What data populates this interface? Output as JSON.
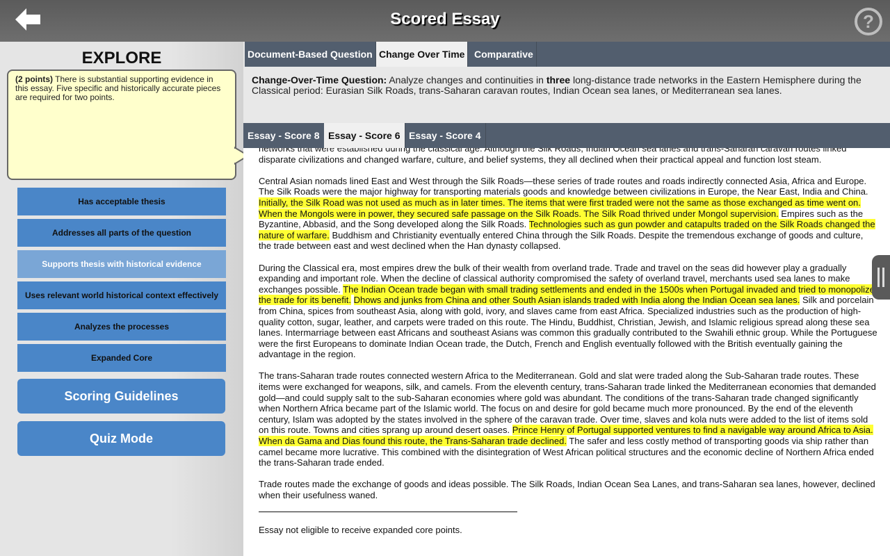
{
  "header": {
    "title": "Scored Essay",
    "back_icon": "back-arrow-icon",
    "help_icon": "help-question-icon"
  },
  "sidebar": {
    "heading": "EXPLORE",
    "callout": {
      "points": "(2 points)",
      "text": " There is substantial supporting evidence in this essay. Five specific and historically accurate pieces are required for two points."
    },
    "rubric_items": [
      {
        "label": "Has acceptable thesis",
        "active": false
      },
      {
        "label": "Addresses all parts of the question",
        "active": false
      },
      {
        "label": "Supports thesis with historical evidence",
        "active": true
      },
      {
        "label": "Uses relevant world historical context effectively",
        "active": false
      },
      {
        "label": "Analyzes the processes",
        "active": false
      },
      {
        "label": "Expanded Core",
        "active": false
      }
    ],
    "buttons": {
      "scoring_guidelines": "Scoring Guidelines",
      "quiz_mode": "Quiz Mode"
    }
  },
  "main": {
    "question_tabs": [
      {
        "label": "Document-Based Question",
        "active": false
      },
      {
        "label": "Change Over Time",
        "active": true
      },
      {
        "label": "Comparative",
        "active": false
      }
    ],
    "question": {
      "label": "Change-Over-Time Question:",
      "text_before": " Analyze changes and continuities in ",
      "emphasis": "three",
      "text_after": " long-distance trade networks in the Eastern Hemisphere during the Classical period: Eurasian Silk Roads, trans-Saharan caravan routes, Indian Ocean sea lanes, or Mediterranean sea lanes."
    },
    "essay_tabs": [
      {
        "label": "Essay - Score 8",
        "active": false
      },
      {
        "label": "Essay - Score 6",
        "active": true
      },
      {
        "label": "Essay - Score 4",
        "active": false
      }
    ],
    "essay": {
      "p1": [
        {
          "t": "networks that were established during the classical age. Although the Silk Roads, Indian Ocean sea lanes and trans-Saharan caravan routes linked disparate civilizations and changed warfare, culture, and belief systems, they all declined when their practical appeal and function lost steam.",
          "hl": false
        }
      ],
      "p2": [
        {
          "t": "Central Asian nomads lined East and West through the Silk Roads—these series of trade routes and roads indirectly connected Asia, Africa and Europe. The Silk Roads were the major highway for transporting materials goods and knowledge between civilizations in Europe, the Near East, India and China. ",
          "hl": false
        },
        {
          "t": "Initially, the Silk Road was not used as much as in later times. The items that were first traded were not the same as those exchanged as time went on. When the Mongols were in power, they secured safe passage on the Silk Roads. The Silk Road thrived under Mongol supervision.",
          "hl": true
        },
        {
          "t": " Empires such as the Byzantine, Abbasid, and the Song developed along the Silk Roads.  ",
          "hl": false
        },
        {
          "t": "Technologies such as gun powder and catapults traded on the Silk Roads changed the nature of warfare.",
          "hl": true
        },
        {
          "t": " Buddhism and Christianity eventually entered China through the Silk Roads. Despite the tremendous exchange of goods and culture, the trade between east and west declined when the Han dynasty collapsed.",
          "hl": false
        }
      ],
      "p3": [
        {
          "t": "During the Classical era, most empires drew the bulk of their wealth from overland trade. Trade and travel on the seas did however play a gradually expanding and important role. When the decline of classical authority compromised the safety of overland travel, merchants used sea lanes to make exchanges possible. ",
          "hl": false
        },
        {
          "t": "The Indian Ocean trade began with small trading settlements and ended in the 1500s when Portugal invaded and tried to monopolize the trade for its benefit.",
          "hl": true
        },
        {
          "t": " ",
          "hl": false
        },
        {
          "t": "Dhows and junks from China and other South Asian islands traded with India along the Indian Ocean sea lanes.",
          "hl": true
        },
        {
          "t": " Silk and porcelain from China, spices from southeast Asia, along with gold, ivory, and slaves came from east Africa. Specialized industries such as the production of high-quality cotton, sugar, leather, and carpets were traded on this route. The Hindu, Buddhist, Christian, Jewish, and Islamic religious spread along these sea lanes. Intermarriage between east Africans and southeast Asians was common this gradually contributed to the Swahili ethnic group. While the Portuguese were the first Europeans to dominate Indian Ocean trade, the Dutch, French and English eventually followed with the British eventually gaining the advantage in the region.",
          "hl": false
        }
      ],
      "p4": [
        {
          "t": " The trans-Saharan trade routes connected western Africa to the Mediterranean. Gold and slat were traded along the Sub-Saharan trade routes. These items were exchanged for weapons, silk, and camels. From the eleventh century, trans-Saharan trade linked the Mediterranean economies that demanded gold—and could supply salt to the sub-Saharan economies where gold was abundant.  The conditions of the trans-Saharan trade changed significantly when Northern Africa became part of the Islamic world. The focus on and desire for gold became much more pronounced. By the end of the eleventh century, Islam was adopted by the states involved in the sphere of the caravan trade. Over time, slaves and kola nuts were added to the list of items sold on this route. Towns and cities sprang up around desert oases. ",
          "hl": false
        },
        {
          "t": "Prince Henry of Portugal supported ventures to find a navigable way around Africa to Asia. When da Gama and Dias found this route, the Trans-Saharan trade declined.",
          "hl": true
        },
        {
          "t": " The safer and less costly method of transporting goods via ship rather than camel became more lucrative. This combined with the disintegration of West African political structures and the economic decline of Northern Africa ended the trans-Saharan trade ended.",
          "hl": false
        }
      ],
      "p5": [
        {
          "t": "Trade routes made the exchange of goods and ideas possible. The Silk Roads, Indian Ocean Sea Lanes, and trans-Saharan sea lanes, however, declined when their usefulness waned.",
          "hl": false
        }
      ],
      "footer_note": "Essay not eligible to receive expanded core points."
    }
  },
  "colors": {
    "highlight": "#ffff33",
    "rubric_blue": "#4a86c8",
    "rubric_active": "#7aa6d6",
    "tabbar": "#525e6e",
    "callout_bg": "#ffffcc"
  }
}
